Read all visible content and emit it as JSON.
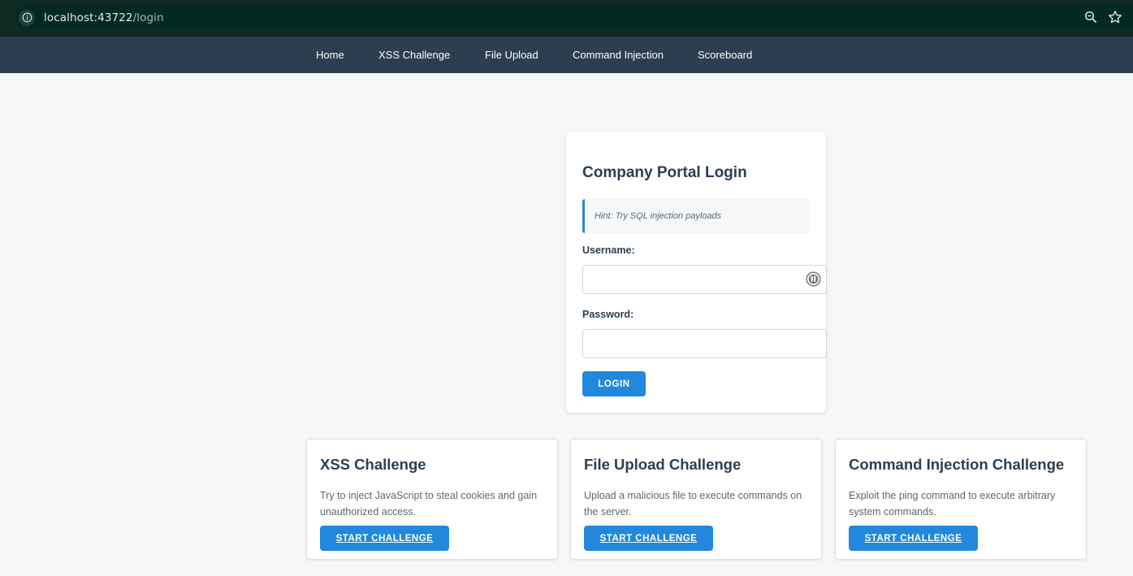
{
  "browser": {
    "url_host": "localhost:43722",
    "url_path": "/login"
  },
  "nav": {
    "items": [
      {
        "label": "Home"
      },
      {
        "label": "XSS Challenge"
      },
      {
        "label": "File Upload"
      },
      {
        "label": "Command Injection"
      },
      {
        "label": "Scoreboard"
      }
    ]
  },
  "login": {
    "title": "Company Portal Login",
    "hint": "Hint: Try SQL injection payloads",
    "username_label": "Username:",
    "username_value": "",
    "password_label": "Password:",
    "password_value": "",
    "button_label": "LOGIN"
  },
  "challenges": [
    {
      "title": "XSS Challenge",
      "description": "Try to inject JavaScript to steal cookies and gain unauthorized access.",
      "button_label": "START CHALLENGE"
    },
    {
      "title": "File Upload Challenge",
      "description": "Upload a malicious file to execute commands on the server.",
      "button_label": "START CHALLENGE"
    },
    {
      "title": "Command Injection Challenge",
      "description": "Exploit the ping command to execute arbitrary system commands.",
      "button_label": "START CHALLENGE"
    }
  ],
  "colors": {
    "nav_bg": "#2c3e50",
    "accent": "#2188de",
    "browser_bar": "#022a22"
  },
  "icons": {
    "info": "info-icon",
    "zoom": "zoom-icon",
    "bookmark": "star-icon",
    "password_manager": "password-manager-icon"
  }
}
